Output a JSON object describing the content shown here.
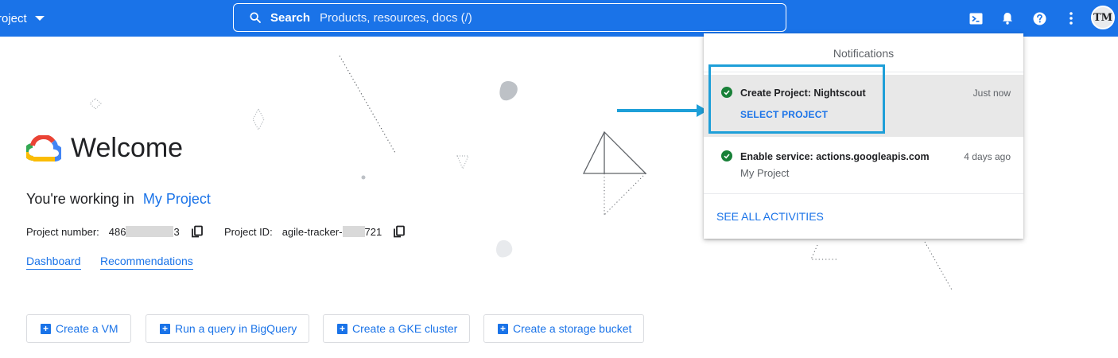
{
  "topbar": {
    "project_picker_label": "roject",
    "search_label": "Search",
    "search_placeholder": "Products, resources, docs (/)",
    "avatar_initials": "TM"
  },
  "welcome": {
    "title": "Welcome",
    "working_in_label": "You're working in",
    "project_name": "My Project",
    "project_number_label": "Project number:",
    "project_number_prefix": "486",
    "project_number_suffix": "3",
    "project_id_label": "Project ID:",
    "project_id_prefix": "agile-tracker-",
    "project_id_suffix": "721",
    "links": [
      "Dashboard",
      "Recommendations"
    ]
  },
  "actions": [
    "Create a VM",
    "Run a query in BigQuery",
    "Create a GKE cluster",
    "Create a storage bucket"
  ],
  "notifications": {
    "title": "Notifications",
    "items": [
      {
        "title": "Create Project: Nightscout",
        "time": "Just now",
        "action": "SELECT PROJECT",
        "status": "success"
      },
      {
        "title": "Enable service: actions.googleapis.com",
        "time": "4 days ago",
        "subtitle": "My Project",
        "status": "success"
      }
    ],
    "see_all": "SEE ALL ACTIVITIES"
  },
  "colors": {
    "topbar": "#1a73e8",
    "link": "#1a73e8",
    "success": "#188038",
    "highlight": "#1e9fd8"
  }
}
